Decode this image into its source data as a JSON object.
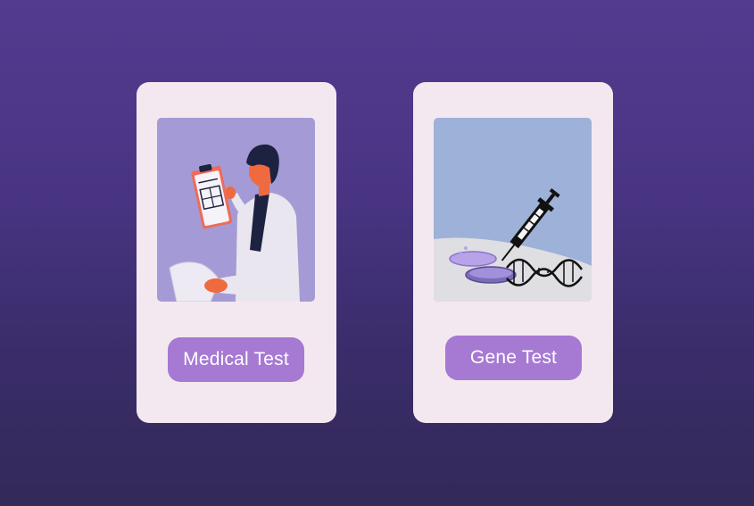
{
  "cards": [
    {
      "button_label": "Medical Test",
      "illustration_icon": "doctor-with-clipboard-icon",
      "illustration_bg": "#a49bd6"
    },
    {
      "button_label": "Gene Test",
      "illustration_icon": "syringe-dna-petri-dish-icon",
      "illustration_bg": "#9eb1d8"
    }
  ],
  "colors": {
    "background_top": "#533b8f",
    "background_bottom": "#332a58",
    "card": "#f4e8f0",
    "button": "#a679d3",
    "button_text": "#ffffff"
  }
}
